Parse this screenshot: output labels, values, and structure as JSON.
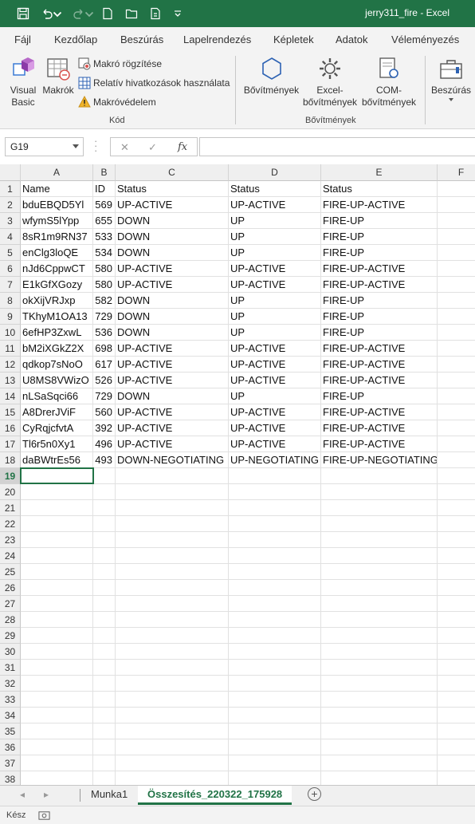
{
  "titlebar": {
    "title": "jerry311_fire  -  Excel"
  },
  "tabs": [
    "Fájl",
    "Kezdőlap",
    "Beszúrás",
    "Lapelrendezés",
    "Képletek",
    "Adatok",
    "Véleményezés"
  ],
  "ribbon": {
    "visual_basic": "Visual\nBasic",
    "makrok": "Makrók",
    "makro_rogzitese": "Makró rögzítése",
    "relativ": "Relatív hivatkozások használata",
    "makrovedelem": "Makróvédelem",
    "kod_label": "Kód",
    "bovitmenyek": "Bővítmények",
    "excel_bov": "Excel-\nbővítmények",
    "com_bov": "COM-\nbővítmények",
    "bov_label": "Bővítmények",
    "beszuras": "Beszúrás"
  },
  "formula_bar": {
    "name_box": "G19",
    "fx": "fx",
    "value": ""
  },
  "columns": [
    "A",
    "B",
    "C",
    "D",
    "E",
    "F"
  ],
  "rows": [
    [
      "Name",
      "ID",
      "Status",
      "Status",
      "Status"
    ],
    [
      "bduEBQD5Yl",
      "569",
      "UP-ACTIVE",
      "UP-ACTIVE",
      "FIRE-UP-ACTIVE"
    ],
    [
      "wfymS5lYpp",
      "655",
      "DOWN",
      "UP",
      "FIRE-UP"
    ],
    [
      "8sR1m9RN37",
      "533",
      "DOWN",
      "UP",
      "FIRE-UP"
    ],
    [
      "enClg3loQE",
      "534",
      "DOWN",
      "UP",
      "FIRE-UP"
    ],
    [
      "nJd6CppwCT",
      "580",
      "UP-ACTIVE",
      "UP-ACTIVE",
      "FIRE-UP-ACTIVE"
    ],
    [
      "E1kGfXGozy",
      "580",
      "UP-ACTIVE",
      "UP-ACTIVE",
      "FIRE-UP-ACTIVE"
    ],
    [
      "okXijVRJxp",
      "582",
      "DOWN",
      "UP",
      "FIRE-UP"
    ],
    [
      "TKhyM1OA13",
      "729",
      "DOWN",
      "UP",
      "FIRE-UP"
    ],
    [
      "6efHP3ZxwL",
      "536",
      "DOWN",
      "UP",
      "FIRE-UP"
    ],
    [
      "bM2iXGkZ2X",
      "698",
      "UP-ACTIVE",
      "UP-ACTIVE",
      "FIRE-UP-ACTIVE"
    ],
    [
      "qdkop7sNoO",
      "617",
      "UP-ACTIVE",
      "UP-ACTIVE",
      "FIRE-UP-ACTIVE"
    ],
    [
      "U8MS8VWizO",
      "526",
      "UP-ACTIVE",
      "UP-ACTIVE",
      "FIRE-UP-ACTIVE"
    ],
    [
      "nLSaSqci66",
      "729",
      "DOWN",
      "UP",
      "FIRE-UP"
    ],
    [
      "A8DrerJViF",
      "560",
      "UP-ACTIVE",
      "UP-ACTIVE",
      "FIRE-UP-ACTIVE"
    ],
    [
      "CyRqjcfvtA",
      "392",
      "UP-ACTIVE",
      "UP-ACTIVE",
      "FIRE-UP-ACTIVE"
    ],
    [
      "Tl6r5n0Xy1",
      "496",
      "UP-ACTIVE",
      "UP-ACTIVE",
      "FIRE-UP-ACTIVE"
    ],
    [
      "daBWtrEs56",
      "493",
      "DOWN-NEGOTIATING",
      "UP-NEGOTIATING",
      "FIRE-UP-NEGOTIATING"
    ]
  ],
  "row_numbers": [
    "1",
    "2",
    "3",
    "4",
    "5",
    "6",
    "7",
    "8",
    "9",
    "10",
    "11",
    "12",
    "13",
    "14",
    "15",
    "16",
    "17",
    "18",
    "19",
    "20",
    "21",
    "22",
    "23",
    "24",
    "25",
    "26",
    "27",
    "28",
    "29",
    "30",
    "31",
    "32",
    "33",
    "34",
    "35",
    "36",
    "37",
    "38"
  ],
  "selected_row": "19",
  "sheets": [
    "Munka1",
    "Összesítés_220322_175928"
  ],
  "active_sheet": "Összesítés_220322_175928",
  "status": {
    "ready": "Kész"
  },
  "colors": {
    "accent": "#217346"
  }
}
